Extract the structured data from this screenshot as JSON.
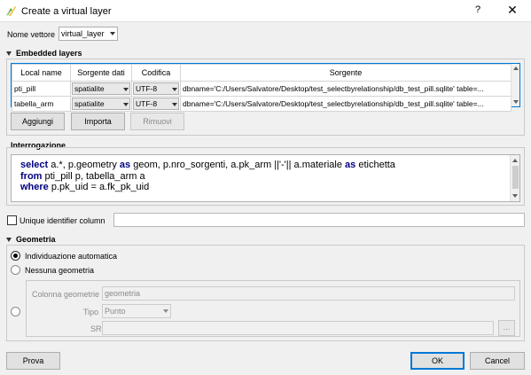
{
  "window": {
    "title": "Create a virtual layer",
    "help_label": "?",
    "close_label": "✕"
  },
  "layer_name": {
    "label": "Nome vettore",
    "value": "virtual_layer"
  },
  "embedded": {
    "title": "Embedded layers",
    "headers": [
      "Local name",
      "Sorgente dati",
      "Codifica",
      "Sorgente"
    ],
    "rows": [
      {
        "local_name": "pti_pill",
        "provider": "spatialite",
        "encoding": "UTF-8",
        "source": "dbname='C:/Users/Salvatore/Desktop/test_selectbyrelationship/db_test_pill.sqlite' table=..."
      },
      {
        "local_name": "tabella_arm",
        "provider": "spatialite",
        "encoding": "UTF-8",
        "source": "dbname='C:/Users/Salvatore/Desktop/test_selectbyrelationship/db_test_pill.sqlite' table=..."
      }
    ],
    "buttons": {
      "add": "Aggiungi",
      "import": "Importa",
      "remove": "Rimuovi"
    }
  },
  "query": {
    "title": "Interrogazione",
    "lines": [
      {
        "k1": "select",
        "t1": " a.*, p.geometry ",
        "k2": "as",
        "t2": " geom, p.nro_sorgenti,  a.pk_arm ||'-'|| a.materiale ",
        "k3": "as",
        "t3": " etichetta"
      },
      {
        "k1": "from",
        "t1": " pti_pill p, tabella_arm a",
        "k2": "",
        "t2": "",
        "k3": "",
        "t3": ""
      },
      {
        "k1": "where",
        "t1": " p.pk_uid = a.fk_pk_uid",
        "k2": "",
        "t2": "",
        "k3": "",
        "t3": ""
      }
    ]
  },
  "uid": {
    "label": "Unique identifier column",
    "value": ""
  },
  "geometry": {
    "title": "Geometria",
    "auto_label": "Individuazione automatica",
    "none_label": "Nessuna geometria",
    "column_label": "Colonna geometrie",
    "column_value": "geometria",
    "type_label": "Tipo",
    "type_value": "Punto",
    "crs_label": "SR",
    "crs_value": "",
    "crs_button": "..."
  },
  "footer": {
    "test": "Prova",
    "ok": "OK",
    "cancel": "Cancel"
  },
  "colors": {
    "selection_border": "#0078d7",
    "keyword": "#000080"
  }
}
